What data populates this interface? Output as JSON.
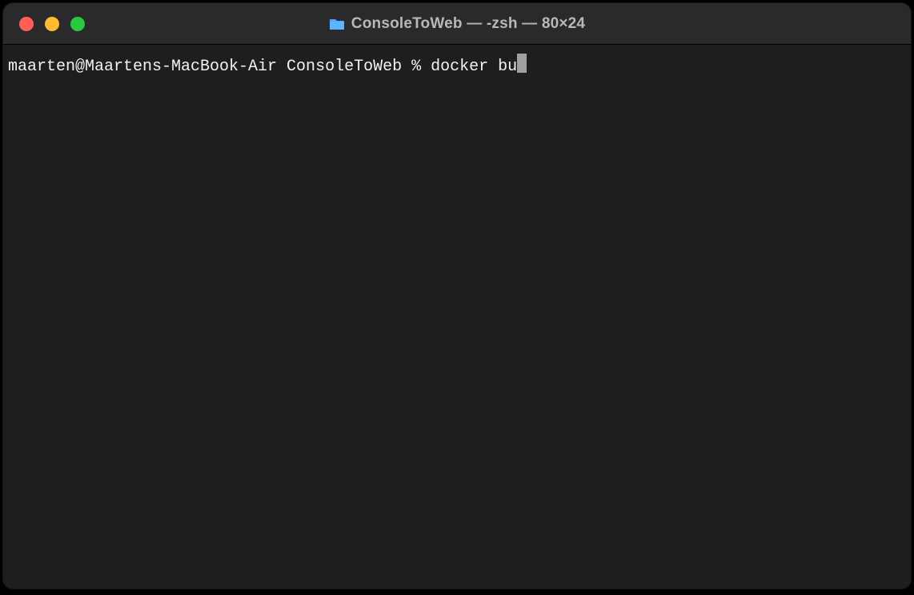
{
  "window": {
    "title": "ConsoleToWeb — -zsh — 80×24"
  },
  "terminal": {
    "prompt": "maarten@Maartens-MacBook-Air ConsoleToWeb % ",
    "command": "docker bu"
  },
  "icons": {
    "folder": "folder-icon"
  },
  "colors": {
    "bg": "#1e1e1e",
    "titlebar": "#2a2a2c",
    "text": "#f2f2f2"
  }
}
